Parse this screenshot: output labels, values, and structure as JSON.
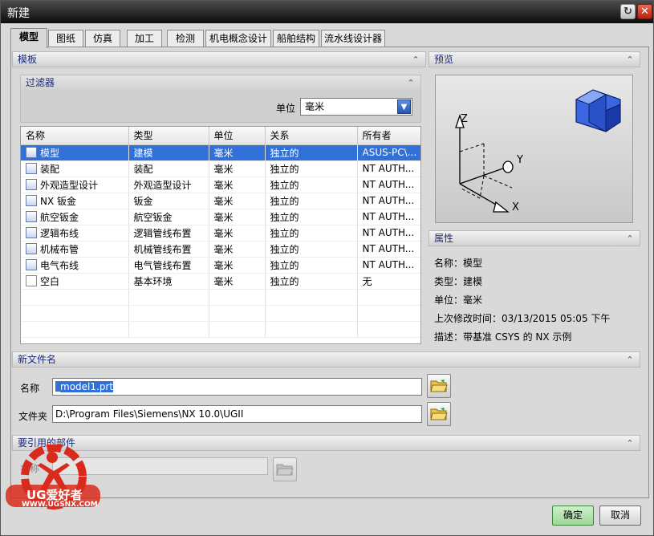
{
  "window": {
    "title": "新建"
  },
  "tabs": [
    {
      "label": "模型",
      "active": true
    },
    {
      "label": "图纸"
    },
    {
      "label": "仿真"
    },
    {
      "label": "加工"
    },
    {
      "label": "检测"
    },
    {
      "label": "机电概念设计"
    },
    {
      "label": "船舶结构"
    },
    {
      "label": "流水线设计器"
    }
  ],
  "template_section": {
    "title": "模板",
    "filter_title": "过滤器",
    "unit_label": "单位",
    "unit_value": "毫米",
    "columns": [
      "名称",
      "类型",
      "单位",
      "关系",
      "所有者"
    ],
    "rows": [
      {
        "icon": "model-icon",
        "name": "模型",
        "type": "建模",
        "unit": "毫米",
        "relation": "独立的",
        "owner": "ASUS-PC\\..."
      },
      {
        "icon": "assembly-icon",
        "name": "装配",
        "type": "装配",
        "unit": "毫米",
        "relation": "独立的",
        "owner": "NT AUTH..."
      },
      {
        "icon": "shape-design-icon",
        "name": "外观造型设计",
        "type": "外观造型设计",
        "unit": "毫米",
        "relation": "独立的",
        "owner": "NT AUTH..."
      },
      {
        "icon": "sheet-metal-icon",
        "name": "NX 钣金",
        "type": "钣金",
        "unit": "毫米",
        "relation": "独立的",
        "owner": "NT AUTH..."
      },
      {
        "icon": "aero-sheet-metal-icon",
        "name": "航空钣金",
        "type": "航空钣金",
        "unit": "毫米",
        "relation": "独立的",
        "owner": "NT AUTH..."
      },
      {
        "icon": "logical-routing-icon",
        "name": "逻辑布线",
        "type": "逻辑管线布置",
        "unit": "毫米",
        "relation": "独立的",
        "owner": "NT AUTH..."
      },
      {
        "icon": "mechanical-routing-icon",
        "name": "机械布管",
        "type": "机械管线布置",
        "unit": "毫米",
        "relation": "独立的",
        "owner": "NT AUTH..."
      },
      {
        "icon": "electrical-routing-icon",
        "name": "电气布线",
        "type": "电气管线布置",
        "unit": "毫米",
        "relation": "独立的",
        "owner": "NT AUTH..."
      },
      {
        "icon": "blank-file-icon",
        "name": "空白",
        "type": "基本环境",
        "unit": "毫米",
        "relation": "独立的",
        "owner": "无"
      }
    ]
  },
  "preview_section": {
    "title": "预览",
    "axis_x": "X",
    "axis_y": "Y",
    "axis_z": "Z"
  },
  "properties_section": {
    "title": "属性",
    "items": [
      {
        "label": "名称：",
        "value": "模型"
      },
      {
        "label": "类型：",
        "value": "建模"
      },
      {
        "label": "单位：",
        "value": "毫米"
      },
      {
        "label": "上次修改时间：",
        "value": "03/13/2015 05:05 下午"
      },
      {
        "label": "描述：",
        "value": "带基准 CSYS 的 NX 示例"
      }
    ]
  },
  "new_file_section": {
    "title": "新文件名",
    "name_label": "名称",
    "name_value": "_model1.prt",
    "folder_label": "文件夹",
    "folder_value": "D:\\Program Files\\Siemens\\NX 10.0\\UGII"
  },
  "reference_section": {
    "title": "要引用的部件",
    "name_label": "名称"
  },
  "watermark": {
    "brand": "UG爱好者",
    "url": "WWW.UGSNX.COM"
  },
  "buttons": {
    "ok": "确定",
    "cancel": "取消"
  }
}
